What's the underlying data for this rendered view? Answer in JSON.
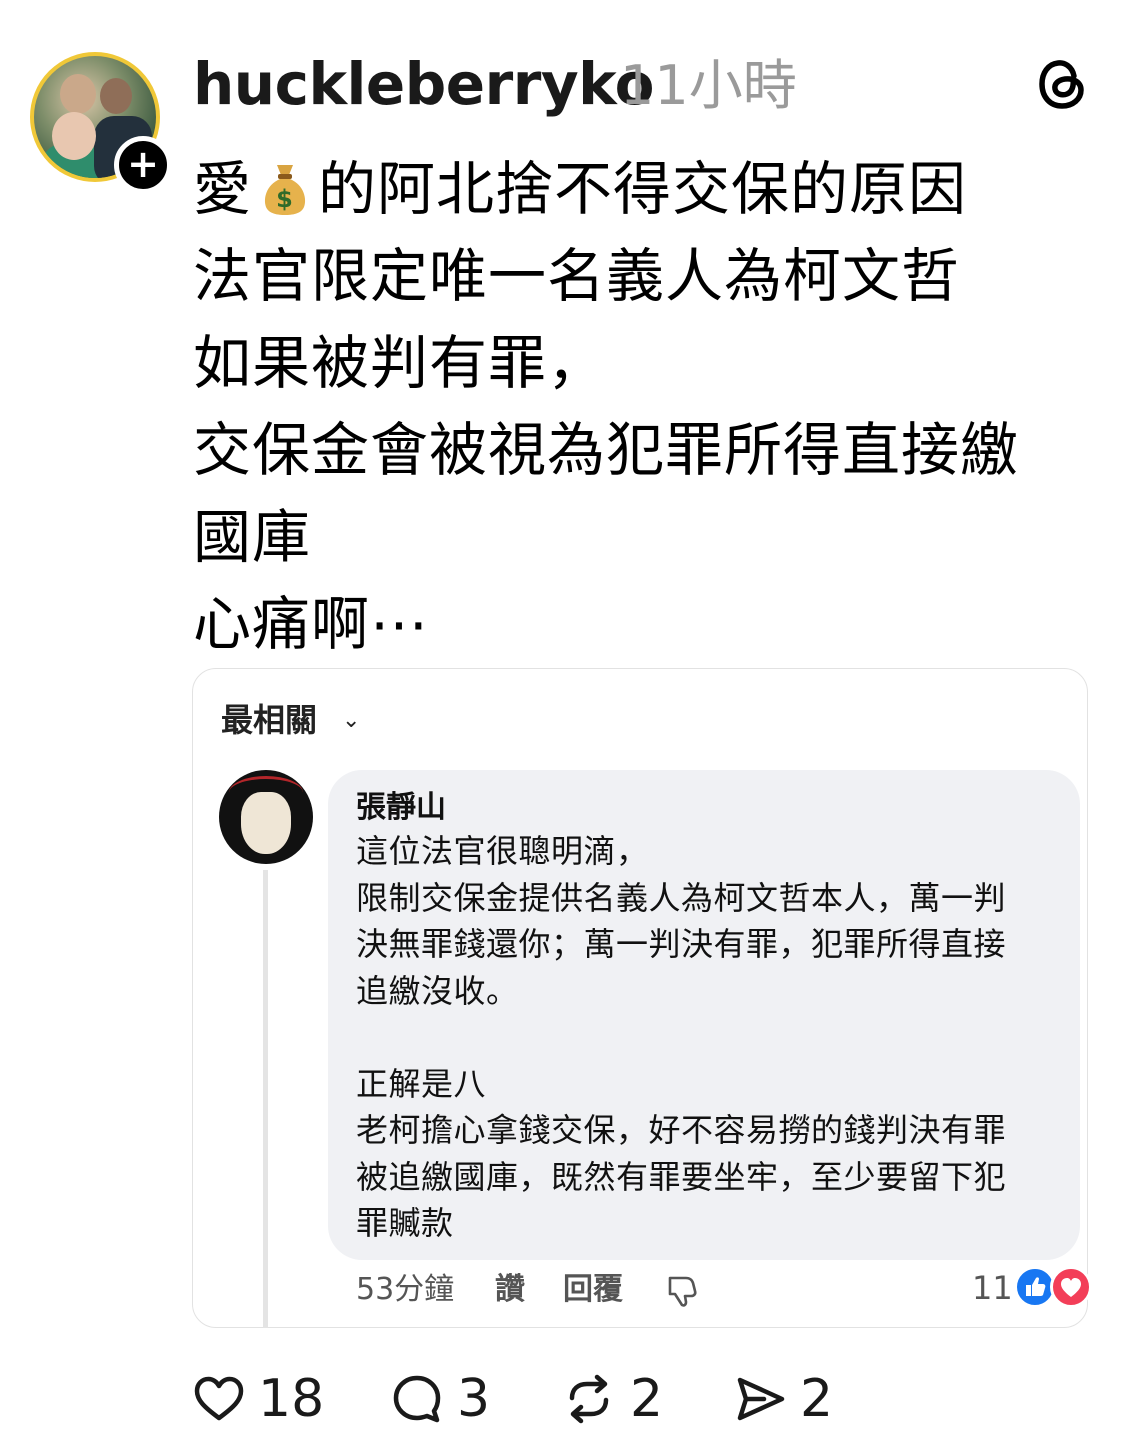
{
  "header": {
    "username": "huckleberryko",
    "timeago": "11小時",
    "follow_label": "+"
  },
  "post": {
    "lines": [
      "的阿北捨不得交保的原因",
      "法官限定唯一名義人為柯文哲",
      "如果被判有罪，",
      "交保金會被視為犯罪所得直接繳",
      "國庫",
      "心痛啊⋯"
    ],
    "line0_prefix": "愛"
  },
  "embed": {
    "sort_label": "最相關",
    "sort_chevron": "⌄",
    "comment": {
      "author": "張靜山",
      "lines": [
        "這位法官很聰明滴，",
        "限制交保金提供名義人為柯文哲本人，萬一判",
        "決無罪錢還你；萬一判決有罪，犯罪所得直接",
        "追繳沒收。",
        "",
        "正解是八",
        "老柯擔心拿錢交保，好不容易撈的錢判決有罪",
        "被追繳國庫，既然有罪要坐牢，至少要留下犯",
        "罪贓款"
      ],
      "time": "53分鐘",
      "like_label": "讚",
      "reply_label": "回覆",
      "reaction_count": "11"
    }
  },
  "actions": {
    "likes": "18",
    "comments": "3",
    "reposts": "2",
    "shares": "2"
  },
  "colors": {
    "bubble_bg": "#f0f1f4",
    "timeago": "#9a9a9a",
    "fb_like": "#1877f2",
    "fb_love": "#f33e58"
  }
}
